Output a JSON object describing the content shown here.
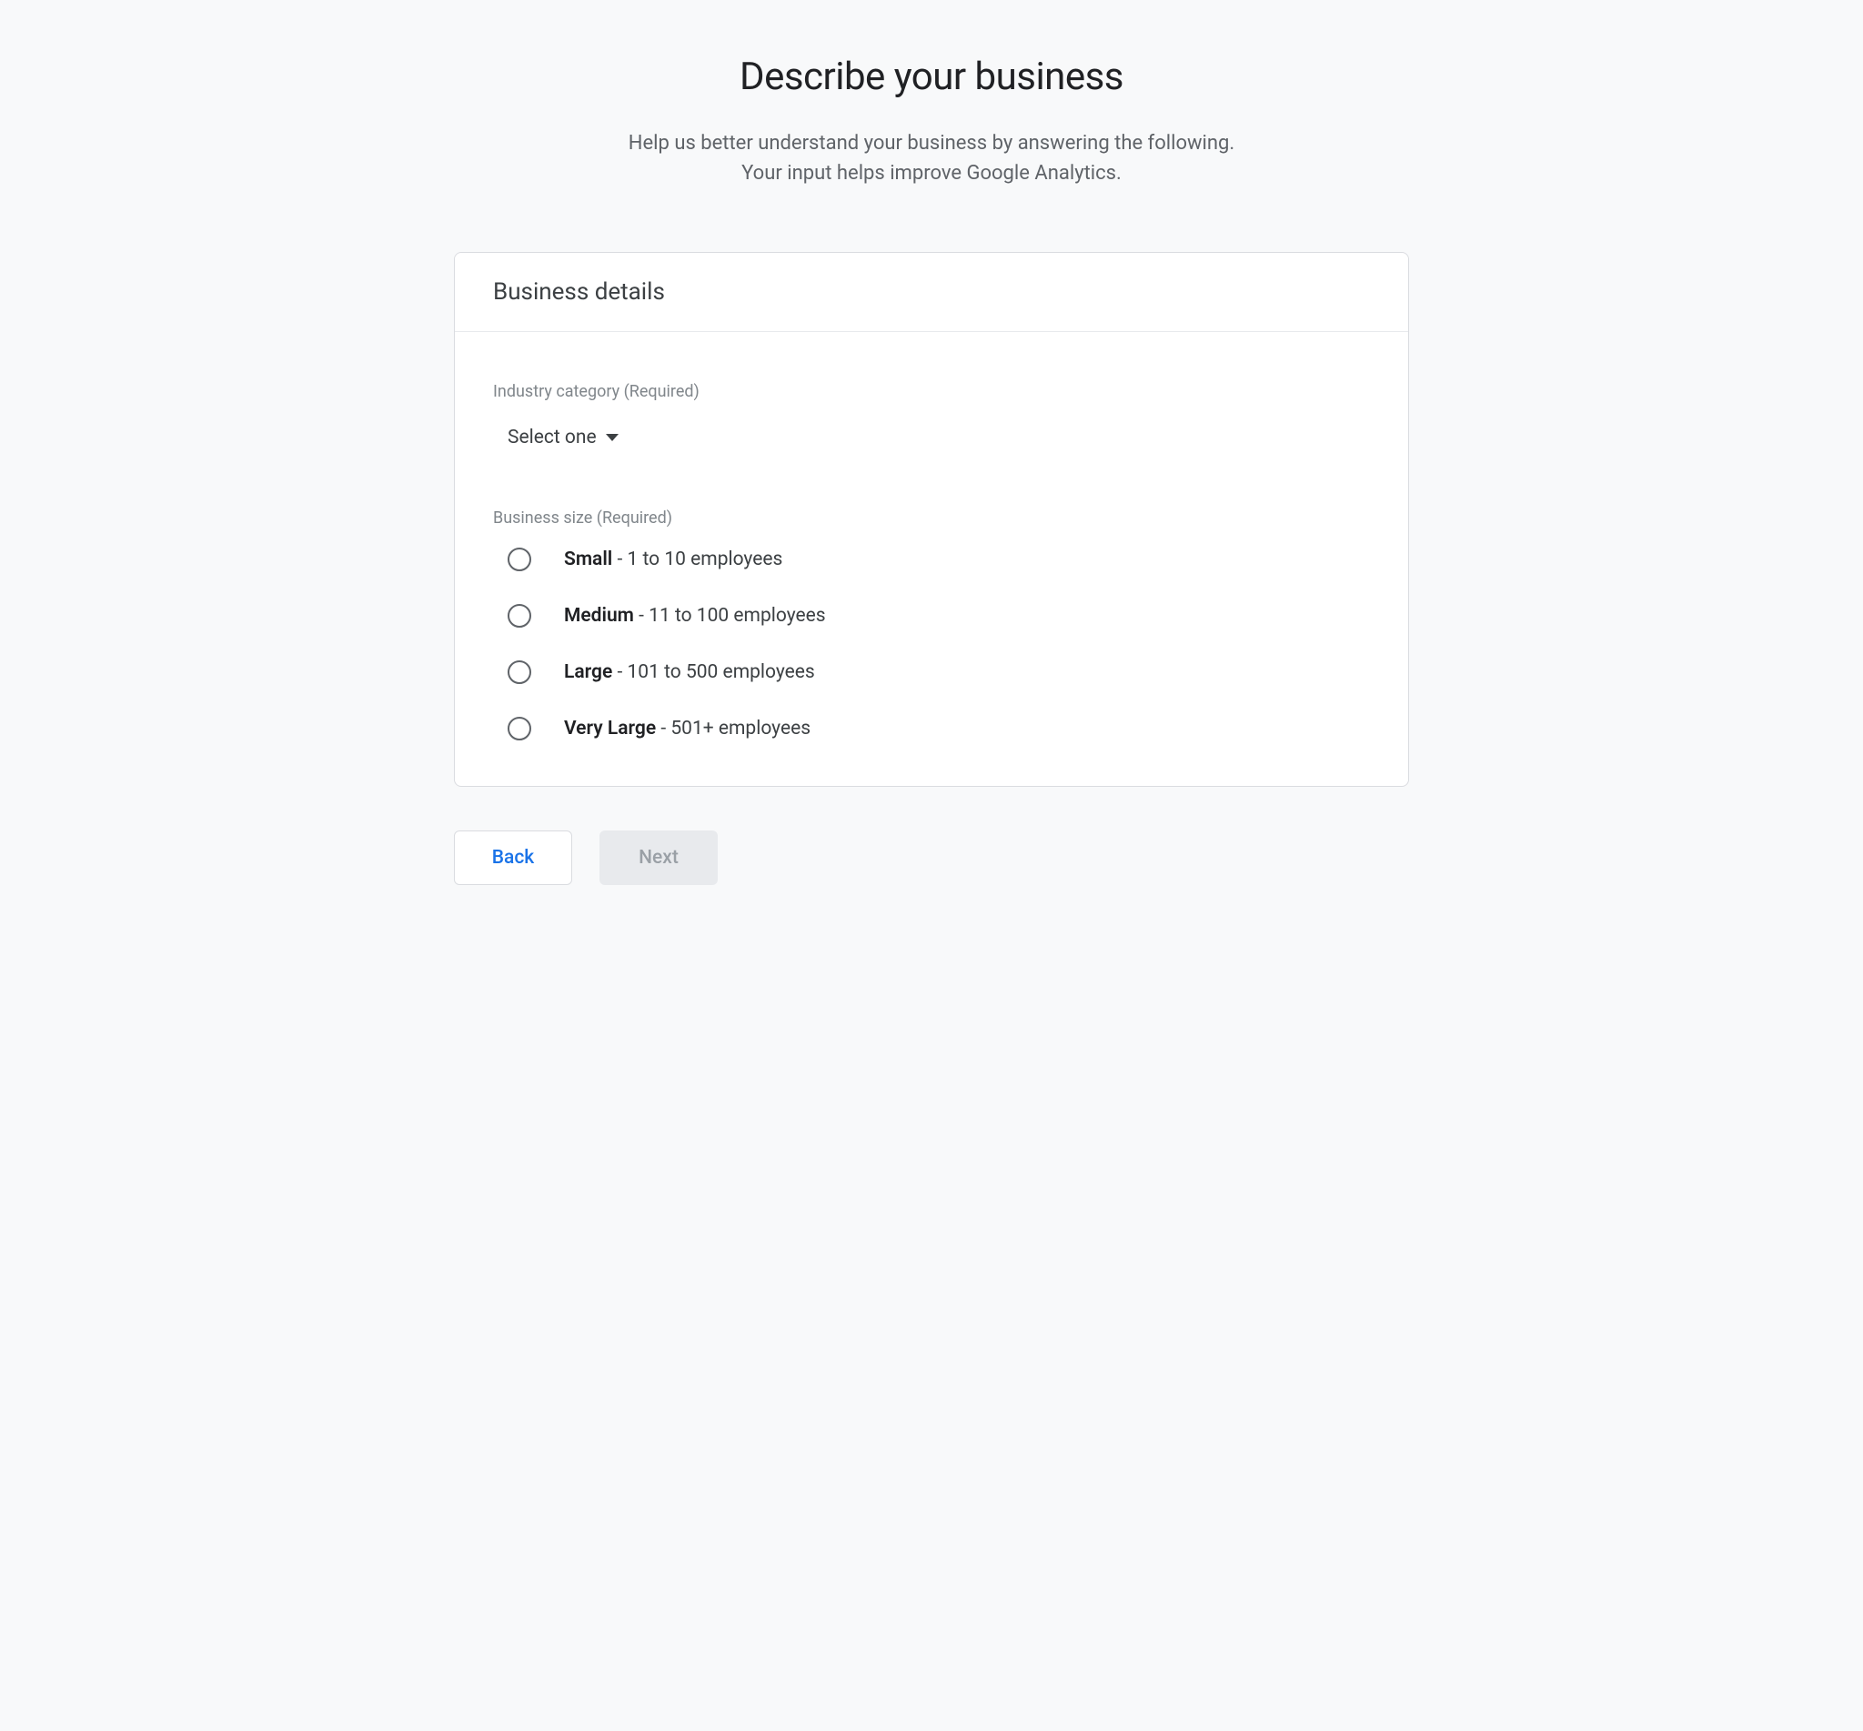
{
  "header": {
    "title": "Describe your business",
    "subtitle_line1": "Help us better understand your business by answering the following.",
    "subtitle_line2": "Your input helps improve Google Analytics."
  },
  "card": {
    "title": "Business details",
    "industry": {
      "label": "Industry category (Required)",
      "selected": "Select one"
    },
    "size": {
      "label": "Business size (Required)",
      "options": [
        {
          "name": "Small",
          "desc": " - 1 to 10 employees"
        },
        {
          "name": "Medium",
          "desc": " - 11 to 100 employees"
        },
        {
          "name": "Large",
          "desc": " - 101 to 500 employees"
        },
        {
          "name": "Very Large",
          "desc": " - 501+ employees"
        }
      ]
    }
  },
  "footer": {
    "back": "Back",
    "next": "Next"
  }
}
